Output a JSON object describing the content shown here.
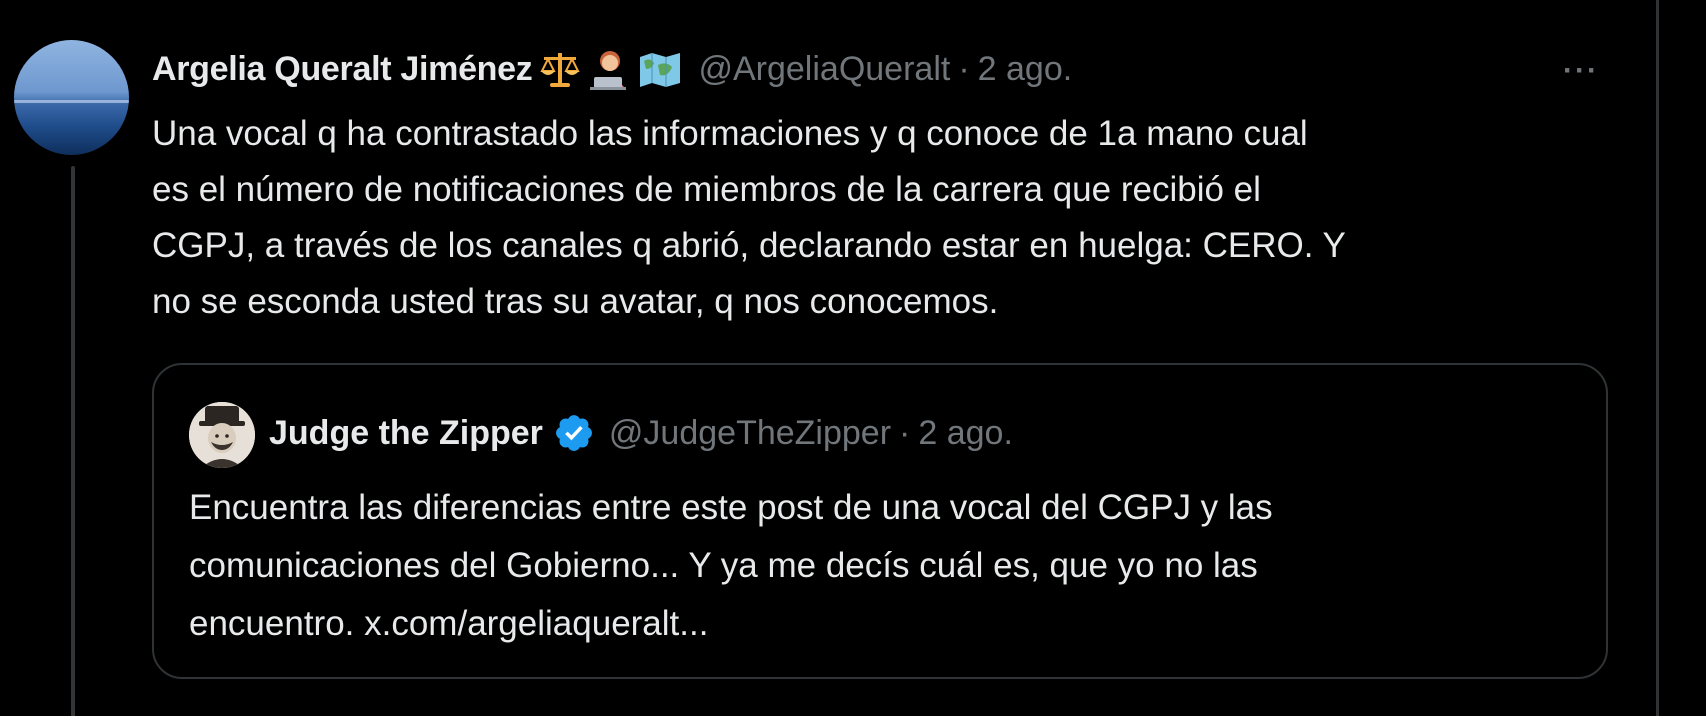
{
  "tweet": {
    "display_name": "Argelia Queralt Jiménez",
    "emojis": [
      "scales-emoji",
      "woman-technologist-emoji",
      "world-map-emoji"
    ],
    "handle": "@ArgeliaQueralt",
    "separator": "·",
    "time": "2 ago.",
    "more_label": "···",
    "text_lines": [
      "Una vocal q ha contrastado las informaciones y q conoce de 1a mano cual",
      "es el número de notificaciones de miembros de la carrera que recibió el",
      "CGPJ, a través de los canales q abrió, declarando estar en huelga: CERO.  Y",
      "no se esconda usted tras su avatar, q nos conocemos."
    ]
  },
  "quoted": {
    "display_name": "Judge the Zipper",
    "verified_icon": "verified-badge-icon",
    "handle": "@JudgeTheZipper",
    "separator": "·",
    "time": "2 ago.",
    "text_lines": [
      "Encuentra las diferencias entre este post de una vocal del CGPJ y las",
      "comunicaciones del Gobierno...  Y ya me decís cuál es, que yo no las",
      "encuentro. x.com/argeliaqueralt..."
    ]
  },
  "colors": {
    "background": "#000000",
    "primary_text": "#e7e9ea",
    "secondary_text": "#71767b",
    "border": "#2f3336",
    "verified_blue": "#1d9bf0"
  }
}
